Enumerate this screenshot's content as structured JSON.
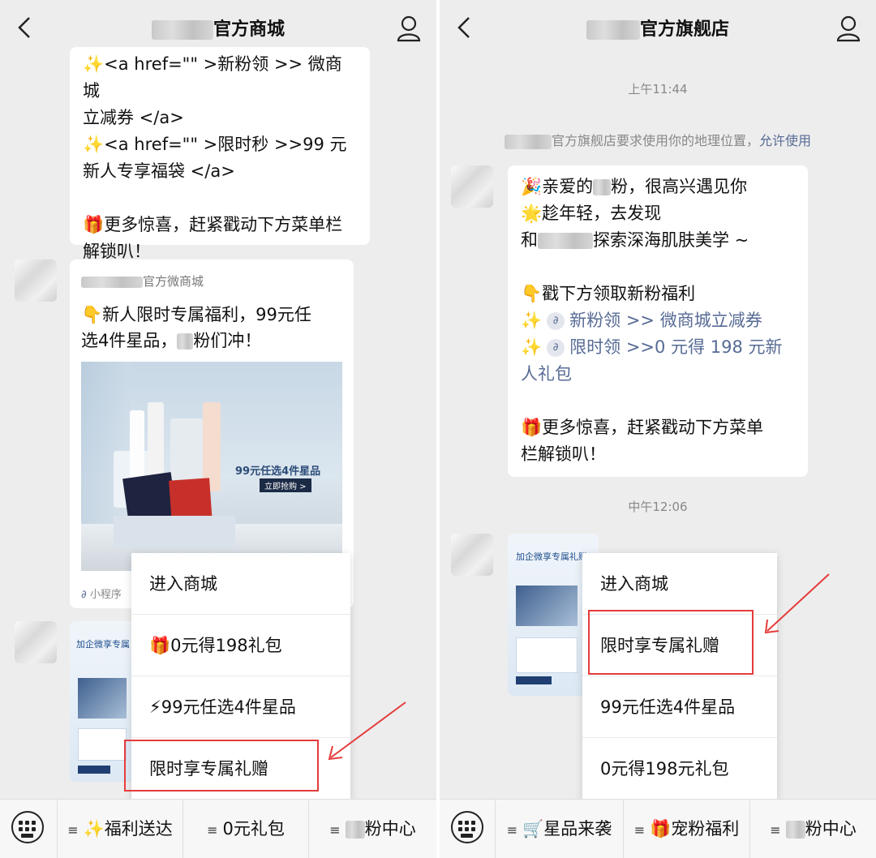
{
  "left": {
    "title": "官方商城",
    "top_bubble_lines": [
      "✨<a href=\"\" >新粉领 >> 微商城",
      "立减券 </a>",
      "✨<a href=\"\" >限时秒 >>99 元",
      "新人专享福袋 </a>",
      "",
      "🎁更多惊喜，赶紧戳动下方菜单栏",
      "解锁叭！"
    ],
    "card": {
      "source": "官方微商城",
      "text_line1": "👇新人限时专属福利，99元任",
      "text_line2_a": "选4件星品，",
      "text_line2_b": "粉们冲！",
      "image_text": "99元任选4件星品",
      "image_button": "立即抢购 >",
      "footer": "小程序"
    },
    "card2_title": "加企微享专属",
    "popup": [
      "进入商城",
      "🎁0元得198礼包",
      "⚡99元任选4件星品",
      "限时享专属礼赠"
    ],
    "menu": [
      {
        "icon": "≡",
        "label": "✨福利送达"
      },
      {
        "icon": "≡",
        "label": "0元礼包"
      },
      {
        "icon": "≡",
        "label": "粉中心"
      }
    ]
  },
  "right": {
    "title": "官方旗舰店",
    "time1": "上午11:44",
    "system_text": "官方旗舰店要求使用你的地理位置，",
    "system_link": "允许使用",
    "msg": {
      "l1a": "🎉亲爱的",
      "l1b": "粉，很高兴遇见你",
      "l2": "🌟趁年轻，去发现",
      "l3a": "和",
      "l3b": "探索深海肌肤美学 ~",
      "l4": "👇戳下方领取新粉福利",
      "l5_prefix": "✨",
      "l5_link": "新粉领 >> 微商城立减券",
      "l6_prefix": "✨",
      "l6_link": "限时领 >>0 元得 198 元新",
      "l6_link2": "人礼包",
      "l7": "🎁更多惊喜，赶紧戳动下方菜单",
      "l8": "栏解锁叭！"
    },
    "time2": "中午12:06",
    "card_title": "加企微享专属礼赠",
    "popup": [
      "进入商城",
      "限时享专属礼赠",
      "99元任选4件星品",
      "0元得198元礼包"
    ],
    "menu": [
      {
        "icon": "≡",
        "label": "🛒星品来袭"
      },
      {
        "icon": "≡",
        "label": "🎁宠粉福利"
      },
      {
        "icon": "≡",
        "label": "粉中心"
      }
    ]
  },
  "colors": {
    "link": "#576b95",
    "highlight": "#e53b3b",
    "background": "#ededed"
  }
}
